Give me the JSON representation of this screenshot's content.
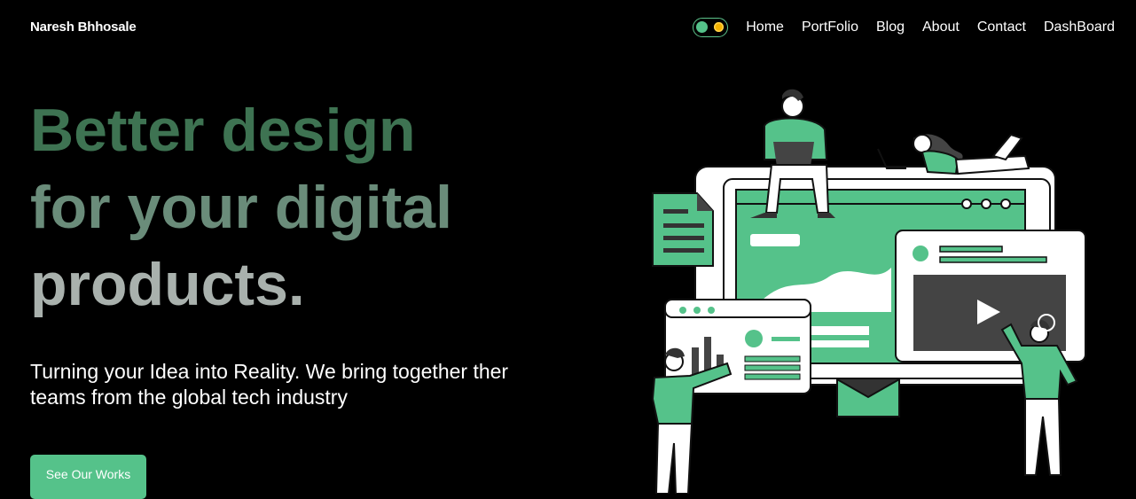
{
  "header": {
    "brand": "Naresh Bhhosale",
    "theme_toggle": {
      "icons": [
        "toggle-knob",
        "sun-icon"
      ],
      "colors": {
        "knob": "#55c28a",
        "sun": "#f5b300"
      }
    },
    "nav": [
      {
        "label": "Home"
      },
      {
        "label": "PortFolio"
      },
      {
        "label": "Blog"
      },
      {
        "label": "About"
      },
      {
        "label": "Contact"
      },
      {
        "label": "DashBoard"
      }
    ]
  },
  "hero": {
    "title_lines": [
      "Better design",
      "for your digital",
      "products."
    ],
    "subtitle": "Turning your Idea into Reality. We bring together ther teams from the global tech industry",
    "cta_label": "See Our Works"
  },
  "colors": {
    "accent": "#55c28a",
    "title_line_1": "#3e7352",
    "title_line_2": "#6a8c7a",
    "title_line_3": "#a9b1ad",
    "background": "#000000"
  }
}
